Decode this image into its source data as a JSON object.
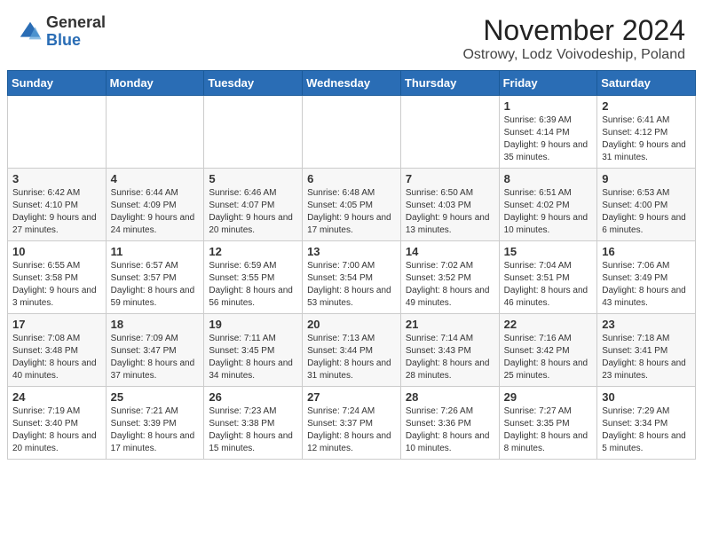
{
  "header": {
    "logo_general": "General",
    "logo_blue": "Blue",
    "month_title": "November 2024",
    "subtitle": "Ostrowy, Lodz Voivodeship, Poland"
  },
  "weekdays": [
    "Sunday",
    "Monday",
    "Tuesday",
    "Wednesday",
    "Thursday",
    "Friday",
    "Saturday"
  ],
  "weeks": [
    [
      {
        "day": "",
        "detail": ""
      },
      {
        "day": "",
        "detail": ""
      },
      {
        "day": "",
        "detail": ""
      },
      {
        "day": "",
        "detail": ""
      },
      {
        "day": "",
        "detail": ""
      },
      {
        "day": "1",
        "detail": "Sunrise: 6:39 AM\nSunset: 4:14 PM\nDaylight: 9 hours\nand 35 minutes."
      },
      {
        "day": "2",
        "detail": "Sunrise: 6:41 AM\nSunset: 4:12 PM\nDaylight: 9 hours\nand 31 minutes."
      }
    ],
    [
      {
        "day": "3",
        "detail": "Sunrise: 6:42 AM\nSunset: 4:10 PM\nDaylight: 9 hours\nand 27 minutes."
      },
      {
        "day": "4",
        "detail": "Sunrise: 6:44 AM\nSunset: 4:09 PM\nDaylight: 9 hours\nand 24 minutes."
      },
      {
        "day": "5",
        "detail": "Sunrise: 6:46 AM\nSunset: 4:07 PM\nDaylight: 9 hours\nand 20 minutes."
      },
      {
        "day": "6",
        "detail": "Sunrise: 6:48 AM\nSunset: 4:05 PM\nDaylight: 9 hours\nand 17 minutes."
      },
      {
        "day": "7",
        "detail": "Sunrise: 6:50 AM\nSunset: 4:03 PM\nDaylight: 9 hours\nand 13 minutes."
      },
      {
        "day": "8",
        "detail": "Sunrise: 6:51 AM\nSunset: 4:02 PM\nDaylight: 9 hours\nand 10 minutes."
      },
      {
        "day": "9",
        "detail": "Sunrise: 6:53 AM\nSunset: 4:00 PM\nDaylight: 9 hours\nand 6 minutes."
      }
    ],
    [
      {
        "day": "10",
        "detail": "Sunrise: 6:55 AM\nSunset: 3:58 PM\nDaylight: 9 hours\nand 3 minutes."
      },
      {
        "day": "11",
        "detail": "Sunrise: 6:57 AM\nSunset: 3:57 PM\nDaylight: 8 hours\nand 59 minutes."
      },
      {
        "day": "12",
        "detail": "Sunrise: 6:59 AM\nSunset: 3:55 PM\nDaylight: 8 hours\nand 56 minutes."
      },
      {
        "day": "13",
        "detail": "Sunrise: 7:00 AM\nSunset: 3:54 PM\nDaylight: 8 hours\nand 53 minutes."
      },
      {
        "day": "14",
        "detail": "Sunrise: 7:02 AM\nSunset: 3:52 PM\nDaylight: 8 hours\nand 49 minutes."
      },
      {
        "day": "15",
        "detail": "Sunrise: 7:04 AM\nSunset: 3:51 PM\nDaylight: 8 hours\nand 46 minutes."
      },
      {
        "day": "16",
        "detail": "Sunrise: 7:06 AM\nSunset: 3:49 PM\nDaylight: 8 hours\nand 43 minutes."
      }
    ],
    [
      {
        "day": "17",
        "detail": "Sunrise: 7:08 AM\nSunset: 3:48 PM\nDaylight: 8 hours\nand 40 minutes."
      },
      {
        "day": "18",
        "detail": "Sunrise: 7:09 AM\nSunset: 3:47 PM\nDaylight: 8 hours\nand 37 minutes."
      },
      {
        "day": "19",
        "detail": "Sunrise: 7:11 AM\nSunset: 3:45 PM\nDaylight: 8 hours\nand 34 minutes."
      },
      {
        "day": "20",
        "detail": "Sunrise: 7:13 AM\nSunset: 3:44 PM\nDaylight: 8 hours\nand 31 minutes."
      },
      {
        "day": "21",
        "detail": "Sunrise: 7:14 AM\nSunset: 3:43 PM\nDaylight: 8 hours\nand 28 minutes."
      },
      {
        "day": "22",
        "detail": "Sunrise: 7:16 AM\nSunset: 3:42 PM\nDaylight: 8 hours\nand 25 minutes."
      },
      {
        "day": "23",
        "detail": "Sunrise: 7:18 AM\nSunset: 3:41 PM\nDaylight: 8 hours\nand 23 minutes."
      }
    ],
    [
      {
        "day": "24",
        "detail": "Sunrise: 7:19 AM\nSunset: 3:40 PM\nDaylight: 8 hours\nand 20 minutes."
      },
      {
        "day": "25",
        "detail": "Sunrise: 7:21 AM\nSunset: 3:39 PM\nDaylight: 8 hours\nand 17 minutes."
      },
      {
        "day": "26",
        "detail": "Sunrise: 7:23 AM\nSunset: 3:38 PM\nDaylight: 8 hours\nand 15 minutes."
      },
      {
        "day": "27",
        "detail": "Sunrise: 7:24 AM\nSunset: 3:37 PM\nDaylight: 8 hours\nand 12 minutes."
      },
      {
        "day": "28",
        "detail": "Sunrise: 7:26 AM\nSunset: 3:36 PM\nDaylight: 8 hours\nand 10 minutes."
      },
      {
        "day": "29",
        "detail": "Sunrise: 7:27 AM\nSunset: 3:35 PM\nDaylight: 8 hours\nand 8 minutes."
      },
      {
        "day": "30",
        "detail": "Sunrise: 7:29 AM\nSunset: 3:34 PM\nDaylight: 8 hours\nand 5 minutes."
      }
    ]
  ]
}
